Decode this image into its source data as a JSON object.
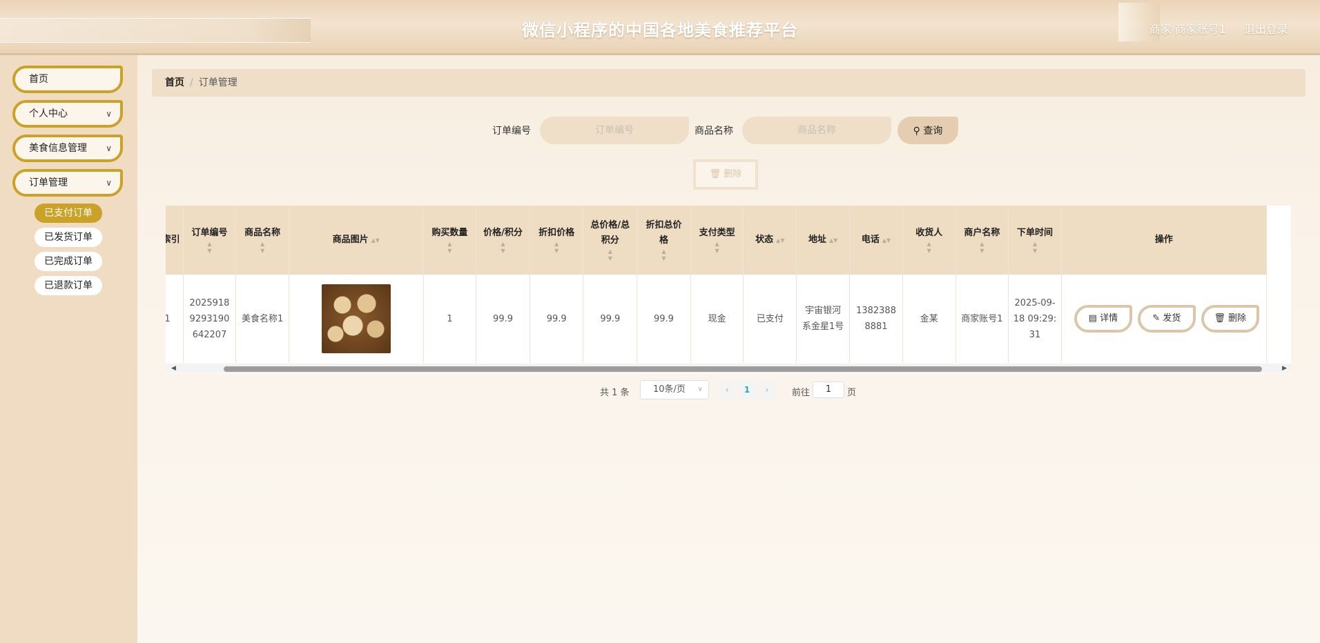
{
  "header": {
    "title": "微信小程序的中国各地美食推荐平台",
    "user": "商家 商家账号1",
    "logout": "退出登录"
  },
  "sidebar": {
    "items": [
      {
        "label": "首页",
        "has_arrow": false
      },
      {
        "label": "个人中心",
        "has_arrow": true
      },
      {
        "label": "美食信息管理",
        "has_arrow": true
      },
      {
        "label": "订单管理",
        "has_arrow": true
      }
    ],
    "sub_items": [
      "已支付订单",
      "已发货订单",
      "已完成订单",
      "已退款订单"
    ],
    "active_sub": "已支付订单"
  },
  "breadcrumb": {
    "home": "首页",
    "separator": "/",
    "current": "订单管理"
  },
  "search": {
    "order_no_label": "订单编号",
    "order_no_placeholder": "订单编号",
    "goods_name_label": "商品名称",
    "goods_name_placeholder": "商品名称",
    "query_button": "查询"
  },
  "toolbar": {
    "delete_button": "删除"
  },
  "table": {
    "columns": [
      "索引",
      "订单编号",
      "商品名称",
      "商品图片",
      "购买数量",
      "价格/积分",
      "折扣价格",
      "总价格/总积分",
      "折扣总价格",
      "支付类型",
      "状态",
      "地址",
      "电话",
      "收货人",
      "商户名称",
      "下单时间",
      "操作"
    ],
    "rows": [
      {
        "index": "1",
        "order_no": "20259189293190642207",
        "goods_name": "美食名称1",
        "image_icon": "dumpling-pastry-image",
        "quantity": "1",
        "price": "99.9",
        "discount_price": "99.9",
        "total_price": "99.9",
        "discount_total": "99.9",
        "pay_type": "现金",
        "status": "已支付",
        "address": "宇宙银河系金星1号",
        "phone": "13823888881",
        "receiver": "金某",
        "merchant": "商家账号1",
        "order_time": "2025-09-18 09:29:31"
      }
    ],
    "actions": {
      "detail": "详情",
      "ship": "发货",
      "delete": "删除"
    }
  },
  "pagination": {
    "total": "共 1 条",
    "page_size": "10条/页",
    "current_page": "1",
    "goto_label": "前往",
    "goto_value": "1",
    "page_unit": "页"
  },
  "colors": {
    "accent_gold": "#c9a227",
    "header_bar": "#ead4b9",
    "sidebar_bg": "#efdcc2",
    "table_header": "#eedcc3"
  }
}
